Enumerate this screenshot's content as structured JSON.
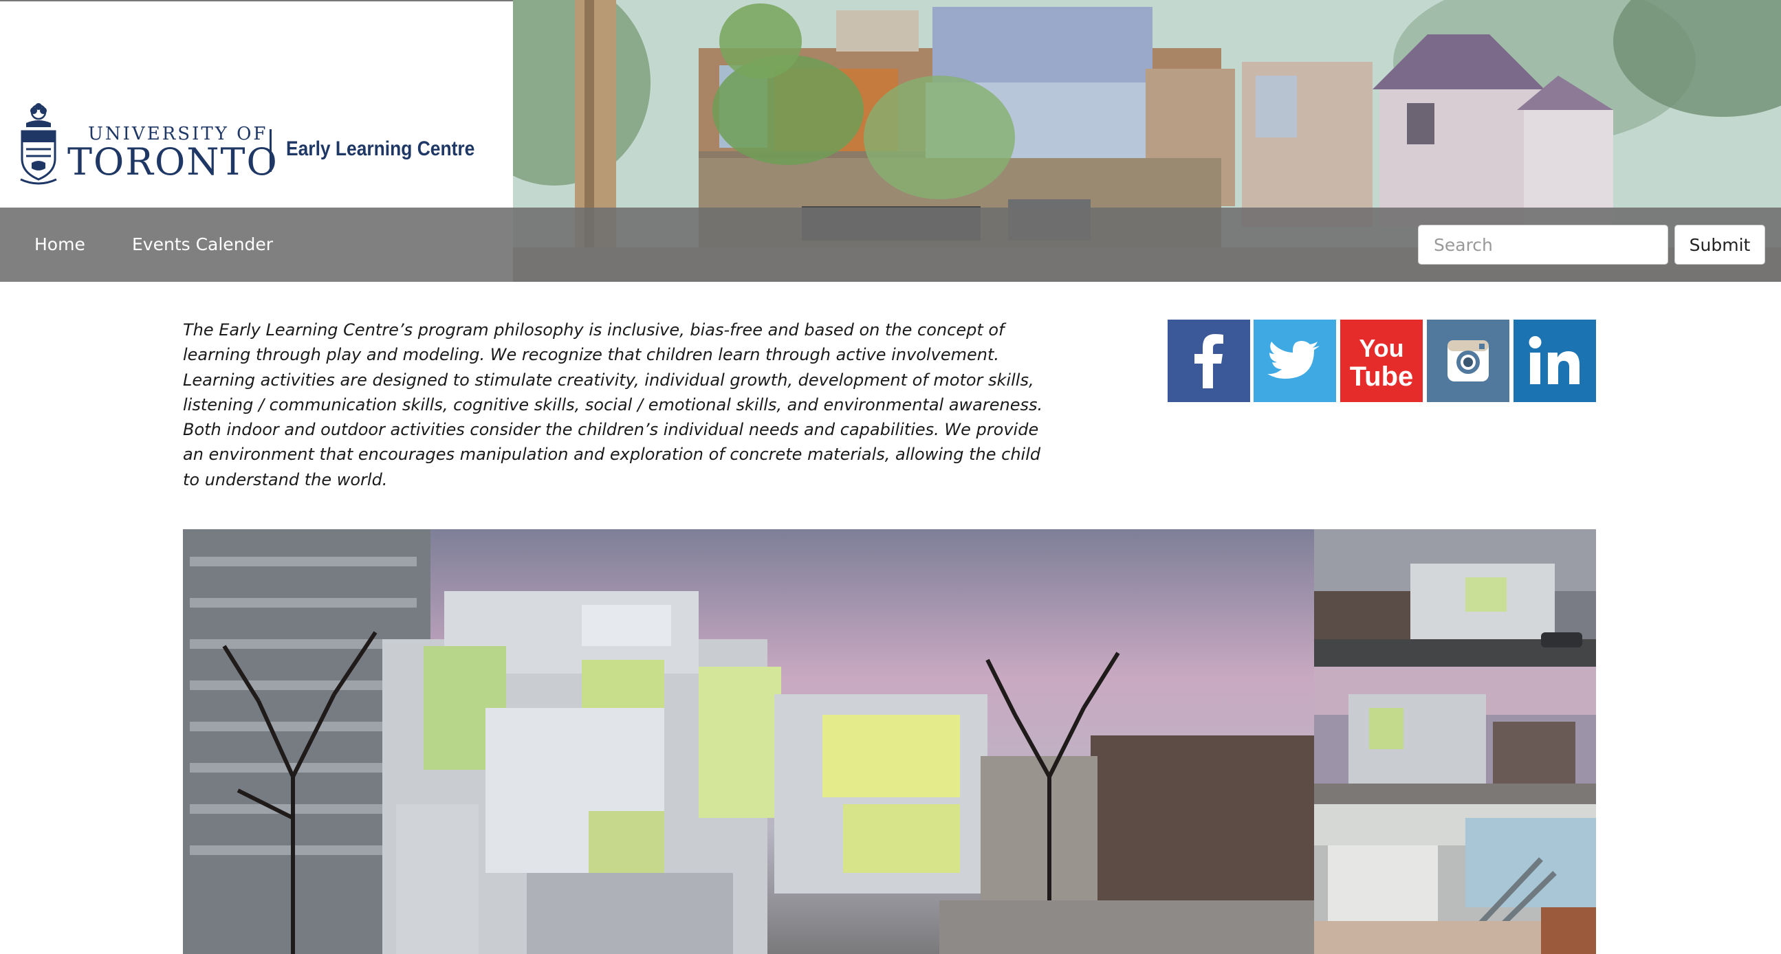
{
  "header": {
    "university_of": "UNIVERSITY OF",
    "university_name": "TORONTO",
    "centre_name": "Early Learning Centre"
  },
  "nav": {
    "items": [
      {
        "label": "Home"
      },
      {
        "label": "Events Calender"
      }
    ]
  },
  "search": {
    "placeholder": "Search",
    "value": "",
    "submit_label": "Submit"
  },
  "intro": {
    "lines": [
      "The Early Learning Centre’s program philosophy is inclusive, bias-free and based on the concept of",
      "learning through play and modeling. We recognize that children learn through active involvement.",
      "Learning activities are designed to stimulate creativity, individual growth, development of motor skills,",
      "listening / communication skills, cognitive skills, social / emotional skills, and environmental awareness.",
      "Both indoor and outdoor activities consider the children’s individual needs and capabilities. We provide",
      "an environment that encourages manipulation and exploration of concrete materials, allowing the child",
      "to understand the world."
    ]
  },
  "social": [
    {
      "name": "facebook",
      "icon": "facebook-icon",
      "color": "#3b5998"
    },
    {
      "name": "twitter",
      "icon": "twitter-icon",
      "color": "#3ea9e2"
    },
    {
      "name": "youtube",
      "icon": "youtube-icon",
      "color": "#e62b2b",
      "text_top": "You",
      "text_bottom": "Tube"
    },
    {
      "name": "instagram",
      "icon": "instagram-icon",
      "color": "#51799d"
    },
    {
      "name": "linkedin",
      "icon": "linkedin-icon",
      "color": "#1b73b2"
    }
  ],
  "colors": {
    "brand_navy": "#1e3765",
    "navbar": "#6e6e6e"
  }
}
